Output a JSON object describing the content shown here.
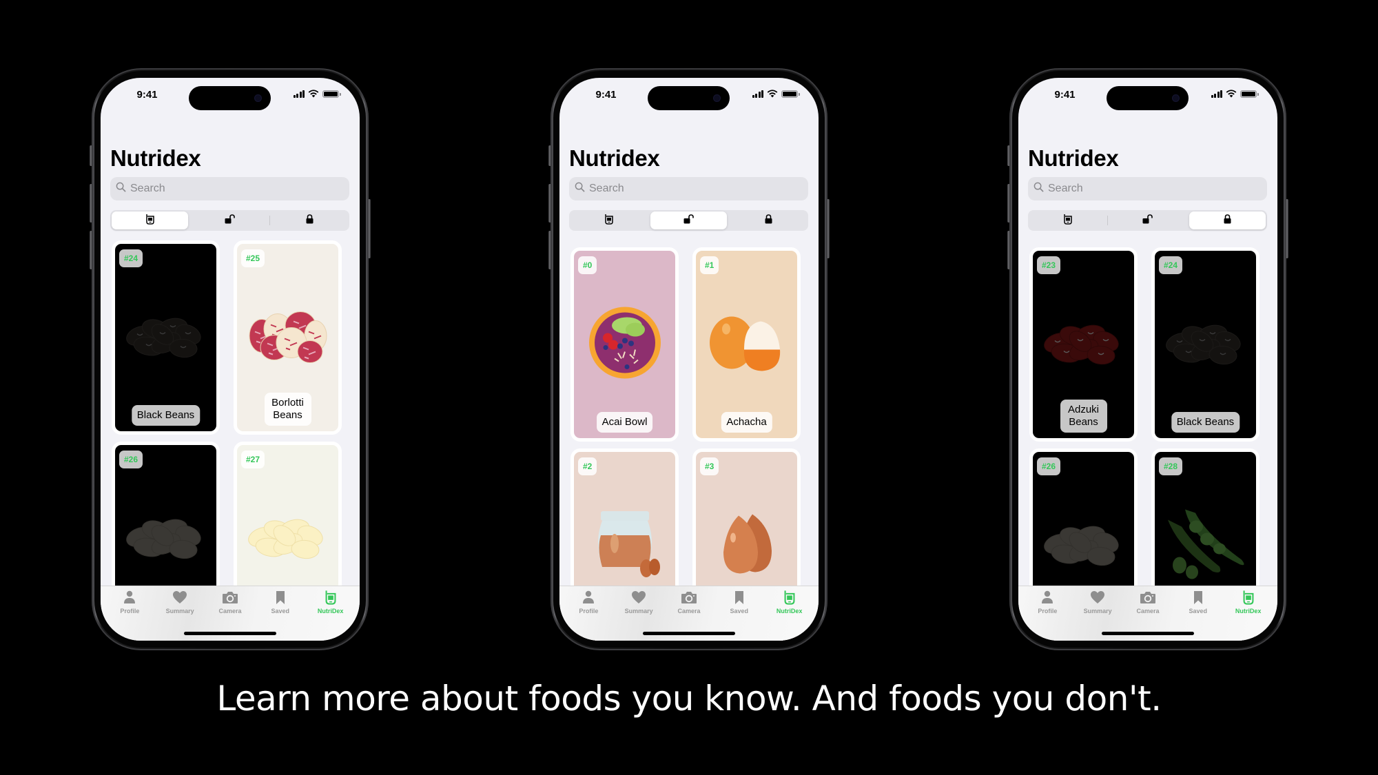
{
  "caption": "Learn more about foods you know. And foods you don't.",
  "colors": {
    "accent_green": "#34c759",
    "screen_bg": "#f2f2f7",
    "search_bg": "#e3e3e8",
    "tab_inactive": "#9a9a9a"
  },
  "phones": [
    {
      "status": {
        "time": "9:41"
      },
      "title": "Nutridex",
      "search": {
        "placeholder": "Search",
        "icon": "magnifying-glass-icon"
      },
      "segments": [
        {
          "icon": "nutridex-device-icon",
          "selected": true
        },
        {
          "icon": "unlock-icon",
          "selected": false
        },
        {
          "icon": "lock-icon",
          "selected": false
        }
      ],
      "cards": [
        {
          "number": "#24",
          "name": "Black Beans",
          "locked": true,
          "art": "black-beans",
          "bg": "#000000"
        },
        {
          "number": "#25",
          "name": "Borlotti Beans",
          "locked": false,
          "art": "borlotti-beans",
          "bg": "#f3efe8"
        },
        {
          "number": "#26",
          "name": "",
          "locked": true,
          "art": "dark-beans",
          "bg": "#000000"
        },
        {
          "number": "#27",
          "name": "",
          "locked": false,
          "art": "butter-beans",
          "bg": "#f3f3ea"
        }
      ],
      "tabs": [
        {
          "label": "Profile",
          "icon": "person-icon",
          "active": false
        },
        {
          "label": "Summary",
          "icon": "heart-icon",
          "active": false
        },
        {
          "label": "Camera",
          "icon": "camera-icon",
          "active": false
        },
        {
          "label": "Saved",
          "icon": "bookmark-icon",
          "active": false
        },
        {
          "label": "NutriDex",
          "icon": "nutridex-device-icon",
          "active": true
        }
      ]
    },
    {
      "status": {
        "time": "9:41"
      },
      "title": "Nutridex",
      "search": {
        "placeholder": "Search",
        "icon": "magnifying-glass-icon"
      },
      "segments": [
        {
          "icon": "nutridex-device-icon",
          "selected": false
        },
        {
          "icon": "unlock-icon",
          "selected": true
        },
        {
          "icon": "lock-icon",
          "selected": false
        }
      ],
      "cards": [
        {
          "number": "#0",
          "name": "Acai Bowl",
          "locked": false,
          "art": "acai-bowl",
          "bg": "#dcb8c8"
        },
        {
          "number": "#1",
          "name": "Achacha",
          "locked": false,
          "art": "achacha",
          "bg": "#f0d8bc"
        },
        {
          "number": "#2",
          "name": "",
          "locked": false,
          "art": "almond-butter",
          "bg": "#ead6cc"
        },
        {
          "number": "#3",
          "name": "",
          "locked": false,
          "art": "almonds",
          "bg": "#ead6cc"
        }
      ],
      "tabs": [
        {
          "label": "Profile",
          "icon": "person-icon",
          "active": false
        },
        {
          "label": "Summary",
          "icon": "heart-icon",
          "active": false
        },
        {
          "label": "Camera",
          "icon": "camera-icon",
          "active": false
        },
        {
          "label": "Saved",
          "icon": "bookmark-icon",
          "active": false
        },
        {
          "label": "NutriDex",
          "icon": "nutridex-device-icon",
          "active": true
        }
      ]
    },
    {
      "status": {
        "time": "9:41"
      },
      "title": "Nutridex",
      "search": {
        "placeholder": "Search",
        "icon": "magnifying-glass-icon"
      },
      "segments": [
        {
          "icon": "nutridex-device-icon",
          "selected": false
        },
        {
          "icon": "unlock-icon",
          "selected": false
        },
        {
          "icon": "lock-icon",
          "selected": true
        }
      ],
      "cards": [
        {
          "number": "#23",
          "name": "Adzuki Beans",
          "locked": true,
          "art": "adzuki-beans",
          "bg": "#000000"
        },
        {
          "number": "#24",
          "name": "Black Beans",
          "locked": true,
          "art": "black-beans",
          "bg": "#000000"
        },
        {
          "number": "#26",
          "name": "",
          "locked": true,
          "art": "dark-beans",
          "bg": "#000000"
        },
        {
          "number": "#28",
          "name": "",
          "locked": true,
          "art": "edamame",
          "bg": "#000000"
        }
      ],
      "tabs": [
        {
          "label": "Profile",
          "icon": "person-icon",
          "active": false
        },
        {
          "label": "Summary",
          "icon": "heart-icon",
          "active": false
        },
        {
          "label": "Camera",
          "icon": "camera-icon",
          "active": false
        },
        {
          "label": "Saved",
          "icon": "bookmark-icon",
          "active": false
        },
        {
          "label": "NutriDex",
          "icon": "nutridex-device-icon",
          "active": true
        }
      ]
    }
  ]
}
